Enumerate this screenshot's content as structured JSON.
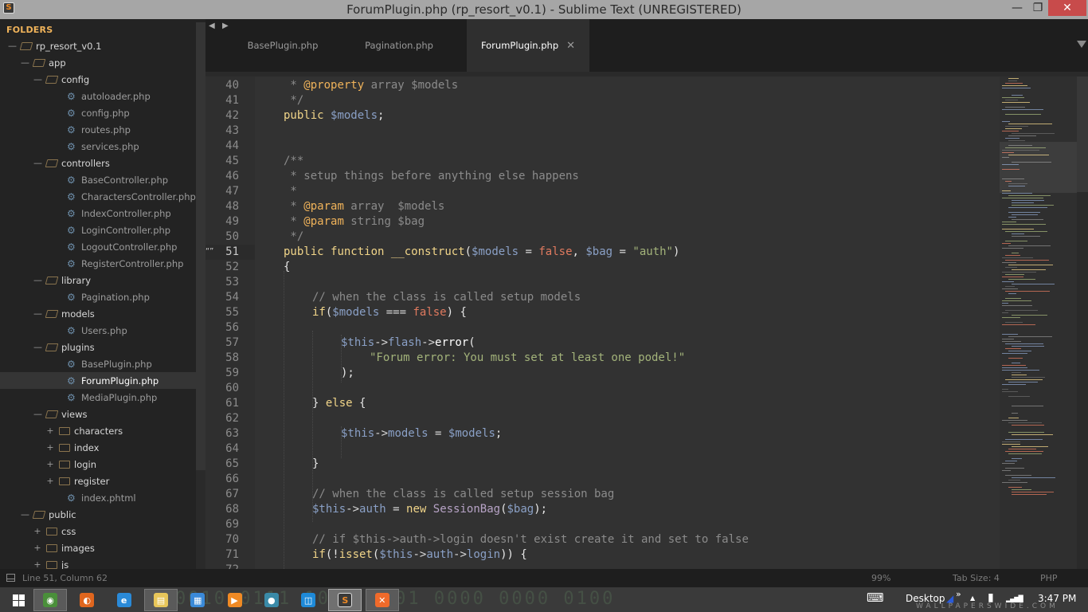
{
  "window": {
    "title": "ForumPlugin.php (rp_resort_v0.1) - Sublime Text (UNREGISTERED)",
    "app_icon_letter": "S",
    "minimize_label": "—",
    "maximize_label": "❐",
    "close_label": "✕"
  },
  "sidebar": {
    "header": "FOLDERS",
    "tree": [
      {
        "label": "rp_resort_v0.1",
        "type": "folder",
        "depth": 0,
        "expanded": true
      },
      {
        "label": "app",
        "type": "folder",
        "depth": 1,
        "expanded": true
      },
      {
        "label": "config",
        "type": "folder",
        "depth": 2,
        "expanded": true
      },
      {
        "label": "autoloader.php",
        "type": "file",
        "depth": 3
      },
      {
        "label": "config.php",
        "type": "file",
        "depth": 3
      },
      {
        "label": "routes.php",
        "type": "file",
        "depth": 3
      },
      {
        "label": "services.php",
        "type": "file",
        "depth": 3
      },
      {
        "label": "controllers",
        "type": "folder",
        "depth": 2,
        "expanded": true
      },
      {
        "label": "BaseController.php",
        "type": "file",
        "depth": 3
      },
      {
        "label": "CharactersController.php",
        "type": "file",
        "depth": 3
      },
      {
        "label": "IndexController.php",
        "type": "file",
        "depth": 3
      },
      {
        "label": "LoginController.php",
        "type": "file",
        "depth": 3
      },
      {
        "label": "LogoutController.php",
        "type": "file",
        "depth": 3
      },
      {
        "label": "RegisterController.php",
        "type": "file",
        "depth": 3
      },
      {
        "label": "library",
        "type": "folder",
        "depth": 2,
        "expanded": true
      },
      {
        "label": "Pagination.php",
        "type": "file",
        "depth": 3
      },
      {
        "label": "models",
        "type": "folder",
        "depth": 2,
        "expanded": true
      },
      {
        "label": "Users.php",
        "type": "file",
        "depth": 3
      },
      {
        "label": "plugins",
        "type": "folder",
        "depth": 2,
        "expanded": true
      },
      {
        "label": "BasePlugin.php",
        "type": "file",
        "depth": 3
      },
      {
        "label": "ForumPlugin.php",
        "type": "file",
        "depth": 3,
        "active": true
      },
      {
        "label": "MediaPlugin.php",
        "type": "file",
        "depth": 3
      },
      {
        "label": "views",
        "type": "folder",
        "depth": 2,
        "expanded": true
      },
      {
        "label": "characters",
        "type": "folder",
        "depth": 3,
        "expanded": false
      },
      {
        "label": "index",
        "type": "folder",
        "depth": 3,
        "expanded": false
      },
      {
        "label": "login",
        "type": "folder",
        "depth": 3,
        "expanded": false
      },
      {
        "label": "register",
        "type": "folder",
        "depth": 3,
        "expanded": false
      },
      {
        "label": "index.phtml",
        "type": "file",
        "depth": 3
      },
      {
        "label": "public",
        "type": "folder",
        "depth": 1,
        "expanded": true
      },
      {
        "label": "css",
        "type": "folder",
        "depth": 2,
        "expanded": false
      },
      {
        "label": "images",
        "type": "folder",
        "depth": 2,
        "expanded": false
      },
      {
        "label": "js",
        "type": "folder",
        "depth": 2,
        "expanded": false
      }
    ]
  },
  "tabs": {
    "prev_label": "◀",
    "next_label": "▶",
    "items": [
      {
        "label": "BasePlugin.php",
        "active": false
      },
      {
        "label": "Pagination.php",
        "active": false
      },
      {
        "label": "ForumPlugin.php",
        "active": true,
        "close": "✕"
      }
    ]
  },
  "editor": {
    "current_line": 51,
    "bookmark_glyph": "“”",
    "lines": [
      {
        "n": "40",
        "indent": 0,
        "tokens": [
          [
            "cm",
            " * "
          ],
          [
            "tag",
            "@property"
          ],
          [
            "cm",
            " array $models"
          ]
        ]
      },
      {
        "n": "41",
        "indent": 0,
        "tokens": [
          [
            "cm",
            " */"
          ]
        ]
      },
      {
        "n": "42",
        "indent": 0,
        "tokens": [
          [
            "kw",
            "public"
          ],
          [
            "plain",
            " "
          ],
          [
            "var",
            "$models"
          ],
          [
            "plain",
            ";"
          ]
        ]
      },
      {
        "n": "43",
        "indent": 0,
        "tokens": []
      },
      {
        "n": "44",
        "indent": 0,
        "tokens": []
      },
      {
        "n": "45",
        "indent": 0,
        "tokens": [
          [
            "cm",
            "/**"
          ]
        ]
      },
      {
        "n": "46",
        "indent": 0,
        "tokens": [
          [
            "cm",
            " * setup things before anything else happens"
          ]
        ]
      },
      {
        "n": "47",
        "indent": 0,
        "tokens": [
          [
            "cm",
            " *"
          ]
        ]
      },
      {
        "n": "48",
        "indent": 0,
        "tokens": [
          [
            "cm",
            " * "
          ],
          [
            "tag",
            "@param"
          ],
          [
            "cm",
            " array  $models"
          ]
        ]
      },
      {
        "n": "49",
        "indent": 0,
        "tokens": [
          [
            "cm",
            " * "
          ],
          [
            "tag",
            "@param"
          ],
          [
            "cm",
            " string $bag"
          ]
        ]
      },
      {
        "n": "50",
        "indent": 0,
        "tokens": [
          [
            "cm",
            " */"
          ]
        ]
      },
      {
        "n": "51",
        "indent": 0,
        "tokens": [
          [
            "kw",
            "public"
          ],
          [
            "plain",
            " "
          ],
          [
            "kw",
            "function"
          ],
          [
            "plain",
            " "
          ],
          [
            "fn",
            "__construct"
          ],
          [
            "plain",
            "("
          ],
          [
            "var",
            "$models"
          ],
          [
            "op",
            " = "
          ],
          [
            "bool",
            "false"
          ],
          [
            "plain",
            ", "
          ],
          [
            "var",
            "$bag"
          ],
          [
            "op",
            " = "
          ],
          [
            "str",
            "\"auth\""
          ],
          [
            "plain",
            ")"
          ]
        ]
      },
      {
        "n": "52",
        "indent": 0,
        "tokens": [
          [
            "plain",
            "{"
          ]
        ]
      },
      {
        "n": "53",
        "indent": 0,
        "tokens": []
      },
      {
        "n": "54",
        "indent": 1,
        "tokens": [
          [
            "cm",
            "// when the class is called setup models"
          ]
        ]
      },
      {
        "n": "55",
        "indent": 1,
        "tokens": [
          [
            "kw",
            "if"
          ],
          [
            "plain",
            "("
          ],
          [
            "var",
            "$models"
          ],
          [
            "op",
            " === "
          ],
          [
            "bool",
            "false"
          ],
          [
            "plain",
            ") {"
          ]
        ]
      },
      {
        "n": "56",
        "indent": 0,
        "tokens": []
      },
      {
        "n": "57",
        "indent": 2,
        "tokens": [
          [
            "var",
            "$this"
          ],
          [
            "op",
            "->"
          ],
          [
            "var",
            "flash"
          ],
          [
            "op",
            "->"
          ],
          [
            "white",
            "error"
          ],
          [
            "plain",
            "("
          ]
        ]
      },
      {
        "n": "58",
        "indent": 3,
        "tokens": [
          [
            "str",
            "\"Forum error: You must set at least one podel!\""
          ]
        ]
      },
      {
        "n": "59",
        "indent": 2,
        "tokens": [
          [
            "plain",
            ");"
          ]
        ]
      },
      {
        "n": "60",
        "indent": 0,
        "tokens": []
      },
      {
        "n": "61",
        "indent": 1,
        "tokens": [
          [
            "plain",
            "} "
          ],
          [
            "kw",
            "else"
          ],
          [
            "plain",
            " {"
          ]
        ]
      },
      {
        "n": "62",
        "indent": 0,
        "tokens": []
      },
      {
        "n": "63",
        "indent": 2,
        "tokens": [
          [
            "var",
            "$this"
          ],
          [
            "op",
            "->"
          ],
          [
            "var",
            "models"
          ],
          [
            "op",
            " = "
          ],
          [
            "var",
            "$models"
          ],
          [
            "plain",
            ";"
          ]
        ]
      },
      {
        "n": "64",
        "indent": 0,
        "tokens": []
      },
      {
        "n": "65",
        "indent": 1,
        "tokens": [
          [
            "plain",
            "}"
          ]
        ]
      },
      {
        "n": "66",
        "indent": 0,
        "tokens": []
      },
      {
        "n": "67",
        "indent": 1,
        "tokens": [
          [
            "cm",
            "// when the class is called setup session bag"
          ]
        ]
      },
      {
        "n": "68",
        "indent": 1,
        "tokens": [
          [
            "var",
            "$this"
          ],
          [
            "op",
            "->"
          ],
          [
            "var",
            "auth"
          ],
          [
            "op",
            " = "
          ],
          [
            "kw",
            "new"
          ],
          [
            "plain",
            " "
          ],
          [
            "cls",
            "SessionBag"
          ],
          [
            "plain",
            "("
          ],
          [
            "var",
            "$bag"
          ],
          [
            "plain",
            ");"
          ]
        ]
      },
      {
        "n": "69",
        "indent": 0,
        "tokens": []
      },
      {
        "n": "70",
        "indent": 1,
        "tokens": [
          [
            "cm",
            "// if $this->auth->login doesn't exist create it and set to false"
          ]
        ]
      },
      {
        "n": "71",
        "indent": 1,
        "tokens": [
          [
            "kw",
            "if"
          ],
          [
            "plain",
            "(!"
          ],
          [
            "kw",
            "isset"
          ],
          [
            "plain",
            "("
          ],
          [
            "var",
            "$this"
          ],
          [
            "op",
            "->"
          ],
          [
            "var",
            "auth"
          ],
          [
            "op",
            "->"
          ],
          [
            "var",
            "login"
          ],
          [
            "plain",
            ")) {"
          ]
        ]
      },
      {
        "n": "72",
        "indent": 0,
        "tokens": []
      }
    ]
  },
  "statusbar": {
    "position": "Line 51, Column 62",
    "zoom": "99%",
    "tab_size": "Tab Size: 4",
    "syntax": "PHP"
  },
  "taskbar": {
    "apps": [
      {
        "name": "chrome",
        "color": "#4a8f3a",
        "glyph": "◉",
        "state": "pinned-active"
      },
      {
        "name": "firefox",
        "color": "#e0661e",
        "glyph": "◐",
        "state": ""
      },
      {
        "name": "internet-explorer",
        "color": "#2a8ad8",
        "glyph": "e",
        "state": ""
      },
      {
        "name": "file-explorer",
        "color": "#e8c65a",
        "glyph": "▤",
        "state": "pinned-active"
      },
      {
        "name": "calculator",
        "color": "#3a8ad8",
        "glyph": "▦",
        "state": ""
      },
      {
        "name": "media-player",
        "color": "#f08a24",
        "glyph": "▶",
        "state": ""
      },
      {
        "name": "messenger",
        "color": "#3a8aa8",
        "glyph": "●",
        "state": ""
      },
      {
        "name": "remote-app",
        "color": "#1e8ad8",
        "glyph": "◫",
        "state": ""
      },
      {
        "name": "sublime-text",
        "color": "#3a3a3a",
        "glyph": "S",
        "state": "running-active"
      },
      {
        "name": "xampp",
        "color": "#f06a2a",
        "glyph": "✕",
        "state": "pinned-active"
      }
    ],
    "keyboard_glyph": "⌨",
    "desktop_label": "Desktop",
    "overflow_glyph": "»",
    "tray_up_glyph": "▲",
    "battery_glyph": "▮",
    "signal_glyph": "▂▄▆█",
    "clock": "3:47 PM",
    "background_binary": "0010 0111 1001 0001 0000 0000 0100",
    "watermark": "WALLPAPERSWIDE.COM"
  }
}
